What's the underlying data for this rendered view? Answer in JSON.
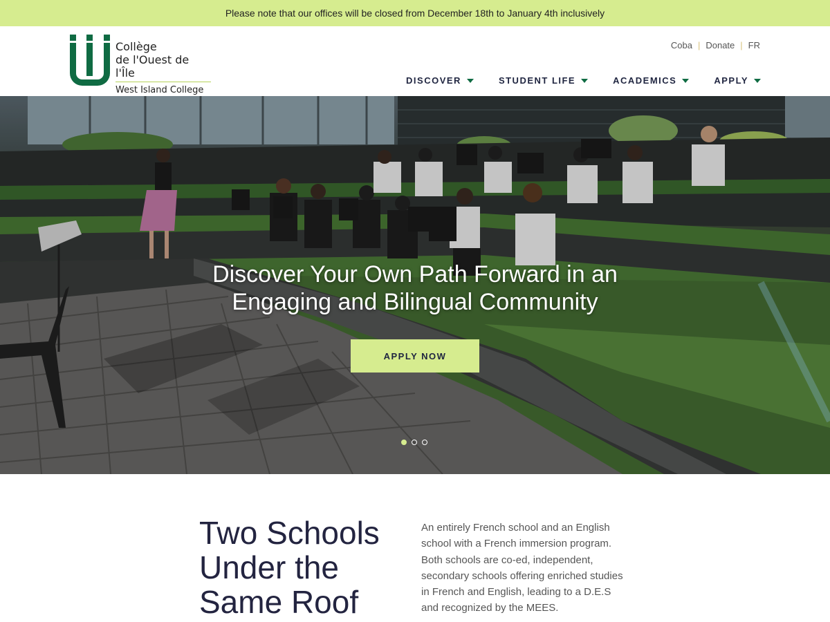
{
  "notice": {
    "text": "Please note that our offices will be closed from December 18th to January 4th inclusively"
  },
  "header": {
    "logo": {
      "line1": "Collège",
      "line2": "de l'Ouest de l'Île",
      "line3": "West Island College"
    },
    "utility": [
      "Coba",
      "Donate",
      "FR"
    ],
    "nav": [
      {
        "label": "DISCOVER"
      },
      {
        "label": "STUDENT LIFE"
      },
      {
        "label": "ACADEMICS"
      },
      {
        "label": "APPLY"
      }
    ]
  },
  "hero": {
    "title_line1": "Discover Your Own Path Forward in an",
    "title_line2": "Engaging and Bilingual Community",
    "cta": "APPLY NOW",
    "slides": 3,
    "active_slide": 1
  },
  "intro": {
    "heading_line1": "Two Schools",
    "heading_line2": "Under the",
    "heading_line3": "Same Roof",
    "body": "An entirely French school and an English school with a French immersion program. Both schools are co-ed, independent, secondary schools offering enriched studies in French and English, leading to a D.E.S and recognized by the MEES."
  },
  "colors": {
    "accent": "#d6ec8f",
    "brand_green": "#0f6b43",
    "navy": "#1f2540"
  },
  "icons": [
    "caret-down-icon"
  ]
}
